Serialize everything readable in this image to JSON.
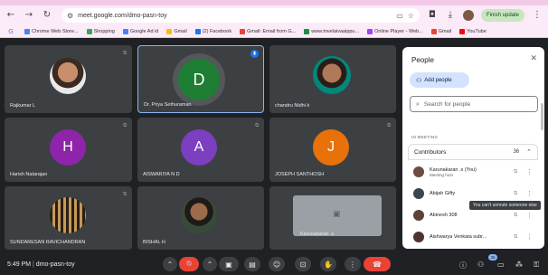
{
  "browser": {
    "url": "meet.google.com/dmo-pasn-toy",
    "update_label": "Finish update",
    "bookmarks": [
      {
        "label": "Chrome Web Store...",
        "color": "#4285f4"
      },
      {
        "label": "Shopping",
        "color": "#34a853"
      },
      {
        "label": "Google Ad id",
        "color": "#4285f4"
      },
      {
        "label": "Gmail",
        "color": "#fbbc04"
      },
      {
        "label": "(2) Facebook",
        "color": "#1877f2"
      },
      {
        "label": "Gmail: Email from G...",
        "color": "#ea4335"
      },
      {
        "label": "www.tnvelaivaaippu...",
        "color": "#1e8e3e"
      },
      {
        "label": "Online Player - Web...",
        "color": "#a142f4"
      },
      {
        "label": "Gmail",
        "color": "#ea4335"
      },
      {
        "label": "YouTube",
        "color": "#ff0000"
      }
    ]
  },
  "tiles": [
    {
      "name": "Rajkumar L",
      "kind": "photo"
    },
    {
      "name": "Dr. Priya Sethuraman",
      "kind": "letter",
      "letter": "D",
      "color": "#1e7e34",
      "active": true
    },
    {
      "name": "chandru Nidhi k",
      "kind": "photo"
    },
    {
      "name": "Harish Natarajan",
      "kind": "letter",
      "letter": "H",
      "color": "#8e24aa"
    },
    {
      "name": "AISWARIYA N D",
      "kind": "letter",
      "letter": "A",
      "color": "#7b3fbf"
    },
    {
      "name": "JOSEPH SANTHOSH",
      "kind": "letter",
      "letter": "J",
      "color": "#e8710a"
    },
    {
      "name": "SUNDARESAN RAVICHANDRAN",
      "kind": "photo"
    },
    {
      "name": "BISHAL H",
      "kind": "photo"
    },
    {
      "name": "Karunakaran .s",
      "kind": "presenting"
    }
  ],
  "panel": {
    "title": "People",
    "add_people": "Add people",
    "search_placeholder": "Search for people",
    "in_meeting": "IN MEETING",
    "section_label": "Contributors",
    "section_count": "36",
    "people": [
      {
        "name": "Karunakaran .s (You)",
        "sub": "Meeting host"
      },
      {
        "name": "Abijah Gifty",
        "sub": ""
      },
      {
        "name": "Abinesh 308",
        "sub": ""
      },
      {
        "name": "Aishwarya Venkata subr...",
        "sub": ""
      }
    ],
    "tooltip": "You can't unmute someone else"
  },
  "controls": {
    "time": "5:49 PM",
    "meeting_code": "dmo-pasn-toy",
    "participants_badge": "36"
  }
}
